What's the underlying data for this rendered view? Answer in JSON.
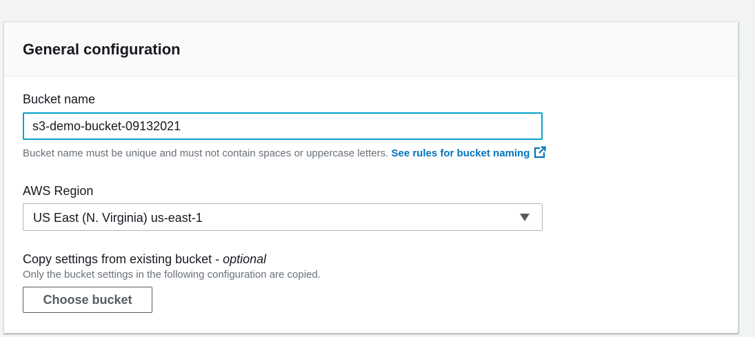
{
  "panel": {
    "title": "General configuration"
  },
  "bucket_name": {
    "label": "Bucket name",
    "value": "s3-demo-bucket-09132021",
    "constraint": "Bucket name must be unique and must not contain spaces or uppercase letters.",
    "rules_link": "See rules for bucket naming",
    "rules_icon": "external-link-icon"
  },
  "region": {
    "label": "AWS Region",
    "selected": "US East (N. Virginia) us-east-1",
    "caret_icon": "caret-down-icon"
  },
  "copy_settings": {
    "label": "Copy settings from existing bucket - ",
    "label_optional": "optional",
    "description": "Only the bucket settings in the following configuration are copied.",
    "button_label": "Choose bucket"
  },
  "colors": {
    "focus_border": "#00a1c9",
    "link": "#0073bb",
    "secondary_text": "#687078",
    "button_border": "#545b64"
  }
}
